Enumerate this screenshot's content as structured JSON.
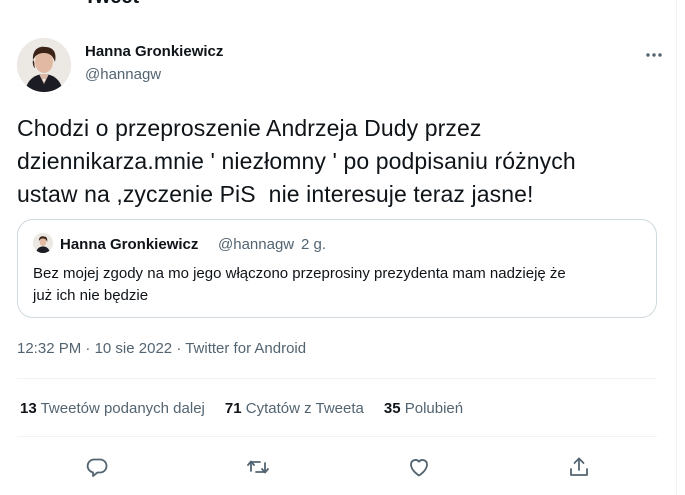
{
  "top_cut_text": "Tweet",
  "author": {
    "name": "Hanna Gronkiewicz",
    "handle": "@hannagw"
  },
  "tweet": {
    "text": "Chodzi o przeproszenie Andrzeja Dudy przez\ndziennikarza.mnie ' niezłomny ' po podpisaniu różnych\nustaw na ,zyczenie PiS  nie interesuje teraz jasne!"
  },
  "quoted_tweet": {
    "name": "Hanna Gronkiewicz",
    "handle": "@hannagw",
    "separator": "·",
    "age": "2 g.",
    "text": "Bez mojej zgody na mo jego włączono przeprosiny prezydenta mam nadzieję że\njuż ich nie będzie"
  },
  "meta": {
    "time": "12:32 PM",
    "dot1": "·",
    "date": "10 sie 2022",
    "dot2": "·",
    "source": "Twitter for Android"
  },
  "stats": {
    "retweets_count": "13",
    "retweets_label": "Tweetów podanych dalej",
    "quotes_count": "71",
    "quotes_label": "Cytatów z Tweeta",
    "likes_count": "35",
    "likes_label": "Polubień"
  },
  "icons": {
    "more": "more-icon",
    "reply": "reply-icon",
    "retweet": "retweet-icon",
    "like": "like-icon",
    "share": "share-icon"
  },
  "colors": {
    "text": "#0f1419",
    "secondary": "#536471",
    "border": "#cfd9de",
    "divider": "#eff3f4"
  }
}
